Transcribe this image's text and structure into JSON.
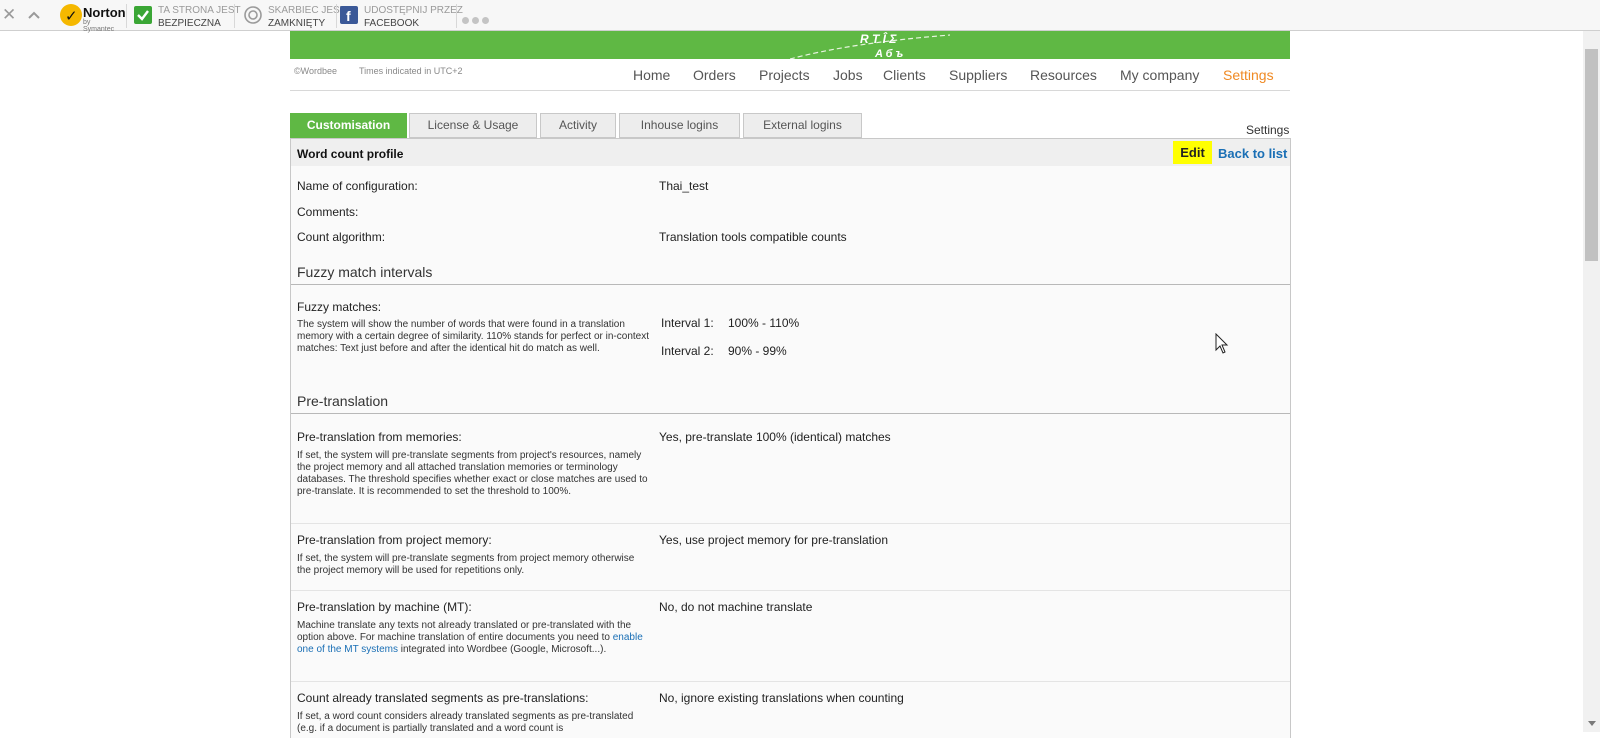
{
  "toolbar": {
    "norton_name": "Norton",
    "norton_sub": "by Symantec",
    "items": [
      {
        "line1": "TA STRONA JEST",
        "line2": "BEZPIECZNA"
      },
      {
        "line1": "SKARBIEC JEST",
        "line2": "ZAMKNIĘTY"
      },
      {
        "line1": "UDOSTĘPNIJ PRZEZ",
        "line2": "FACEBOOK"
      }
    ]
  },
  "header": {
    "copyright": "©Wordbee",
    "timezone": "Times indicated in UTC+2",
    "nav": [
      "Home",
      "Orders",
      "Projects",
      "Jobs",
      "Clients",
      "Suppliers",
      "Resources",
      "My company",
      "Settings"
    ],
    "active_nav": "Settings",
    "accent": "#f08a24",
    "brand_green": "#5fb844"
  },
  "tabs": [
    "Customisation",
    "License & Usage",
    "Activity",
    "Inhouse logins",
    "External logins"
  ],
  "active_tab": "Customisation",
  "breadcrumb": "Settings",
  "panel": {
    "title": "Word count profile",
    "edit_label": "Edit",
    "back_label": "Back to list"
  },
  "config": {
    "name_label": "Name of configuration:",
    "name_value": "Thai_test",
    "comments_label": "Comments:",
    "algorithm_label": "Count algorithm:",
    "algorithm_value": "Translation tools compatible counts"
  },
  "fuzzy": {
    "section": "Fuzzy match intervals",
    "label": "Fuzzy matches:",
    "desc": "The system will show the number of words that were found in a translation memory with a certain degree of similarity. 110% stands for perfect or in-context matches: Text just before and after the identical hit do match as well.",
    "intervals": [
      {
        "label": "Interval 1:",
        "value": "100% - 110%"
      },
      {
        "label": "Interval 2:",
        "value": "90% - 99%"
      }
    ]
  },
  "pretranslation": {
    "section": "Pre-translation",
    "rows": [
      {
        "label": "Pre-translation from memories:",
        "value": "Yes, pre-translate 100% (identical) matches",
        "desc": "If set, the system will pre-translate segments from project's resources, namely the project memory and all attached translation memories or terminology databases. The threshold specifies whether exact or close matches are used to pre-translate. It is recommended to set the threshold to 100%."
      },
      {
        "label": "Pre-translation from project memory:",
        "value": "Yes, use project memory for pre-translation",
        "desc": "If set, the system will pre-translate segments from project memory otherwise the project memory will be used for repetitions only."
      },
      {
        "label": "Pre-translation by machine (MT):",
        "value": "No, do not machine translate",
        "desc_before": "Machine translate any texts not already translated or pre-translated with the option above. For machine translation of entire documents you need to ",
        "desc_link": "enable one of the MT systems",
        "desc_after": " integrated into Wordbee (Google, Microsoft...)."
      },
      {
        "label": "Count already translated segments as pre-translations:",
        "value": "No, ignore existing translations when counting",
        "desc": "If set, a word count considers already translated segments as pre-translated (e.g. if a document is partially translated and a word count is"
      }
    ]
  }
}
